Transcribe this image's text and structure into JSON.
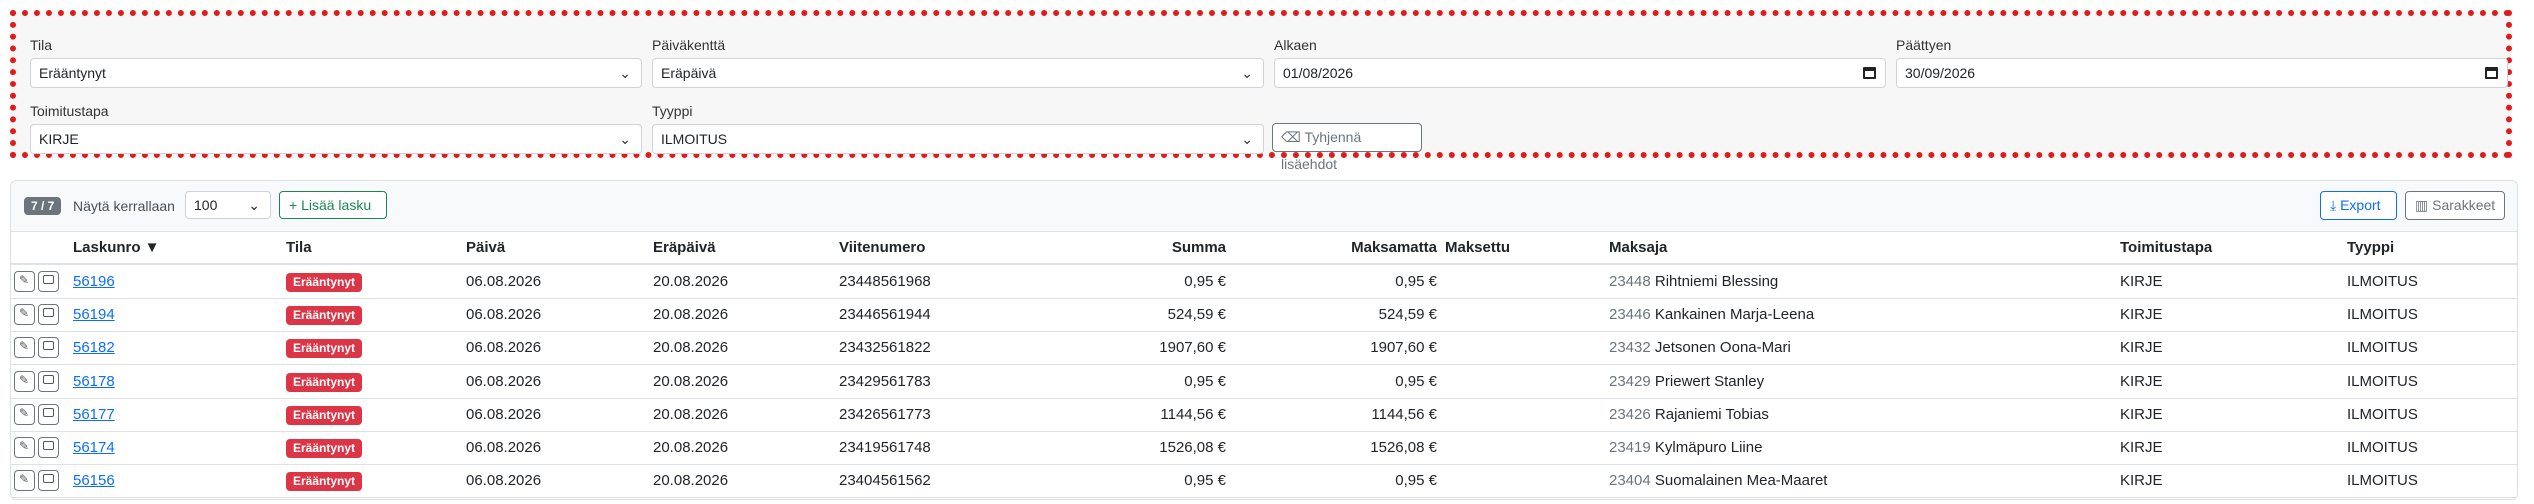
{
  "filters": {
    "tila": {
      "label": "Tila",
      "value": "Erääntynyt"
    },
    "paivakentta": {
      "label": "Päiväkenttä",
      "value": "Eräpäivä"
    },
    "alkaen": {
      "label": "Alkaen",
      "value": "01/08/2026"
    },
    "paattyen": {
      "label": "Päättyen",
      "value": "30/09/2026"
    },
    "toimitustapa": {
      "label": "Toimitustapa",
      "value": "KIRJE"
    },
    "tyyppi": {
      "label": "Tyyppi",
      "value": "ILMOITUS"
    },
    "clear_label": "Tyhjennä lisäehdot"
  },
  "toolbar": {
    "count": "7 / 7",
    "per_page_label": "Näytä kerrallaan",
    "per_page_value": "100",
    "add_label": "Lisää lasku",
    "export_label": "Export",
    "columns_label": "Sarakkeet"
  },
  "table": {
    "headers": {
      "laskunro": "Laskunro ▼",
      "tila": "Tila",
      "paiva": "Päivä",
      "erapaiva": "Eräpäivä",
      "viitenumero": "Viitenumero",
      "summa": "Summa",
      "maksamatta": "Maksamatta",
      "maksettu": "Maksettu",
      "maksaja": "Maksaja",
      "toimitustapa": "Toimitustapa",
      "tyyppi": "Tyyppi"
    },
    "rows": [
      {
        "laskunro": "56196",
        "tila": "Erääntynyt",
        "paiva": "06.08.2026",
        "erapaiva": "20.08.2026",
        "viitenumero": "23448561968",
        "summa": "0,95 €",
        "maksamatta": "0,95 €",
        "maksettu": "",
        "payer_id": "23448",
        "payer_name": "Rihtniemi Blessing",
        "toimitustapa": "KIRJE",
        "tyyppi": "ILMOITUS"
      },
      {
        "laskunro": "56194",
        "tila": "Erääntynyt",
        "paiva": "06.08.2026",
        "erapaiva": "20.08.2026",
        "viitenumero": "23446561944",
        "summa": "524,59 €",
        "maksamatta": "524,59 €",
        "maksettu": "",
        "payer_id": "23446",
        "payer_name": "Kankainen Marja-Leena",
        "toimitustapa": "KIRJE",
        "tyyppi": "ILMOITUS"
      },
      {
        "laskunro": "56182",
        "tila": "Erääntynyt",
        "paiva": "06.08.2026",
        "erapaiva": "20.08.2026",
        "viitenumero": "23432561822",
        "summa": "1907,60 €",
        "maksamatta": "1907,60 €",
        "maksettu": "",
        "payer_id": "23432",
        "payer_name": "Jetsonen Oona-Mari",
        "toimitustapa": "KIRJE",
        "tyyppi": "ILMOITUS"
      },
      {
        "laskunro": "56178",
        "tila": "Erääntynyt",
        "paiva": "06.08.2026",
        "erapaiva": "20.08.2026",
        "viitenumero": "23429561783",
        "summa": "0,95 €",
        "maksamatta": "0,95 €",
        "maksettu": "",
        "payer_id": "23429",
        "payer_name": "Priewert Stanley",
        "toimitustapa": "KIRJE",
        "tyyppi": "ILMOITUS"
      },
      {
        "laskunro": "56177",
        "tila": "Erääntynyt",
        "paiva": "06.08.2026",
        "erapaiva": "20.08.2026",
        "viitenumero": "23426561773",
        "summa": "1144,56 €",
        "maksamatta": "1144,56 €",
        "maksettu": "",
        "payer_id": "23426",
        "payer_name": "Rajaniemi Tobias",
        "toimitustapa": "KIRJE",
        "tyyppi": "ILMOITUS"
      },
      {
        "laskunro": "56174",
        "tila": "Erääntynyt",
        "paiva": "06.08.2026",
        "erapaiva": "20.08.2026",
        "viitenumero": "23419561748",
        "summa": "1526,08 €",
        "maksamatta": "1526,08 €",
        "maksettu": "",
        "payer_id": "23419",
        "payer_name": "Kylmäpuro Liine",
        "toimitustapa": "KIRJE",
        "tyyppi": "ILMOITUS"
      },
      {
        "laskunro": "56156",
        "tila": "Erääntynyt",
        "paiva": "06.08.2026",
        "erapaiva": "20.08.2026",
        "viitenumero": "23404561562",
        "summa": "0,95 €",
        "maksamatta": "0,95 €",
        "maksettu": "",
        "payer_id": "23404",
        "payer_name": "Suomalainen Mea-Maaret",
        "toimitustapa": "KIRJE",
        "tyyppi": "ILMOITUS"
      }
    ]
  },
  "colors": {
    "accent": "#0d6efd",
    "danger": "#dc3545",
    "success": "#198754",
    "highlight_border": "#e01b1b"
  }
}
